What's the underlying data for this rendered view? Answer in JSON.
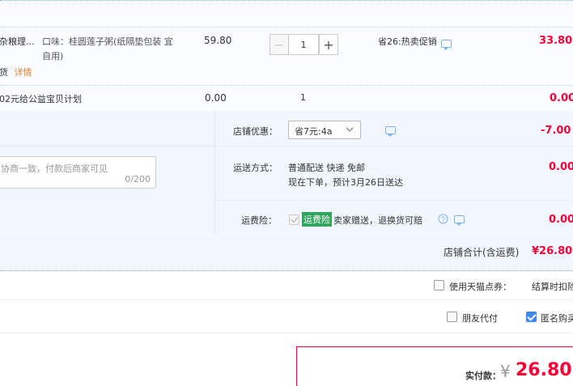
{
  "item": {
    "name_fragment": "杂粮理...",
    "attr": "口味：桂圆莲子粥(纸隔垫包装 宜自用)",
    "attr_line2": "自用)",
    "attr_line1": "口味：桂圆莲子粥(纸隔垫包装 宜",
    "badge_fragment": "货",
    "detail_link": "详情",
    "unit_price": "59.80",
    "quantity": "1",
    "promo": "省26:热卖促销",
    "subtotal": "33.80"
  },
  "charity": {
    "label": "02元给公益宝贝计划",
    "unit_price": "0.00",
    "quantity": "1",
    "subtotal": "0.00"
  },
  "message": {
    "placeholder": "协商一致，付款后商家可见",
    "counter": "0/200"
  },
  "shop_discount": {
    "label": "店铺优惠：",
    "selected": "省7元:4a",
    "amount": "-7.00"
  },
  "shipping": {
    "label": "运送方式：",
    "method": "普通配送 快递 免邮",
    "eta": "现在下单，预计3月26日送达",
    "amount": "0.00"
  },
  "insurance": {
    "label": "运费险：",
    "tag": "运费险",
    "desc": "卖家赠送，退换货可赔",
    "amount": "0.00"
  },
  "shop_total": {
    "label": "店铺合计(含运费)",
    "amount": "¥26.80"
  },
  "coupon": {
    "label": "使用天猫点券：",
    "right_text": "结算时扣除"
  },
  "options": {
    "friend_pay": "朋友代付",
    "anonymous": "匿名购买"
  },
  "payment": {
    "label": "实付款：",
    "currency": "¥",
    "amount": "26.80"
  },
  "colors": {
    "accent_red": "#ff0036",
    "accent_blue": "#3d8af7",
    "insurance_green": "#2fa65c",
    "link_orange": "#e0833a"
  }
}
